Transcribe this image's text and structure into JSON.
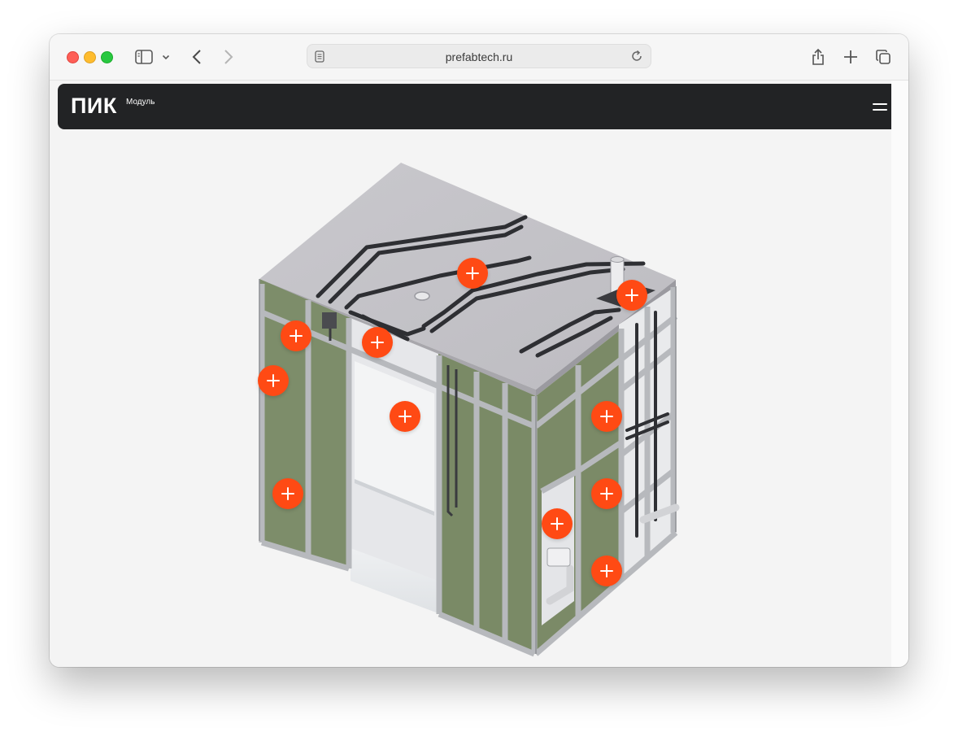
{
  "browser": {
    "url": "prefabtech.ru"
  },
  "site": {
    "logo_main": "ПИК",
    "logo_sub": "Модуль"
  },
  "hotspots": [
    {
      "name": "hotspot-ceiling"
    },
    {
      "name": "hotspot-ventilation"
    },
    {
      "name": "hotspot-wall-top-left"
    },
    {
      "name": "hotspot-door-frame"
    },
    {
      "name": "hotspot-wall-left"
    },
    {
      "name": "hotspot-bathroom-interior"
    },
    {
      "name": "hotspot-side-wall-upper"
    },
    {
      "name": "hotspot-wall-bottom-left"
    },
    {
      "name": "hotspot-side-wall-middle"
    },
    {
      "name": "hotspot-toilet-installation"
    },
    {
      "name": "hotspot-side-wall-bottom"
    }
  ]
}
